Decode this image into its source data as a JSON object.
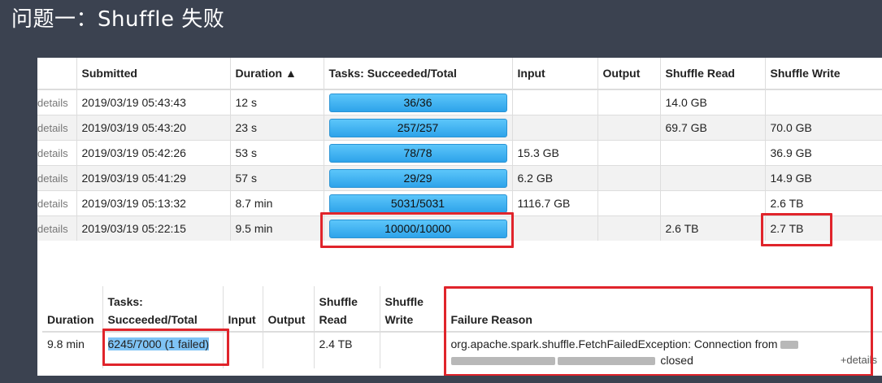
{
  "slide": {
    "title": "问题一：Shuffle 失败"
  },
  "stages_table": {
    "headers": {
      "submitted": "Submitted",
      "duration": "Duration ▲",
      "tasks": "Tasks: Succeeded/Total",
      "input": "Input",
      "output": "Output",
      "shuffle_read": "Shuffle Read",
      "shuffle_write": "Shuffle Write"
    },
    "rows": [
      {
        "details": "details",
        "submitted": "2019/03/19 05:43:43",
        "duration": "12 s",
        "tasks": "36/36",
        "tasks_fraction": 1.0,
        "input": "",
        "output": "",
        "shuffle_read": "14.0 GB",
        "shuffle_write": ""
      },
      {
        "details": "details",
        "submitted": "2019/03/19 05:43:20",
        "duration": "23 s",
        "tasks": "257/257",
        "tasks_fraction": 1.0,
        "input": "",
        "output": "",
        "shuffle_read": "69.7 GB",
        "shuffle_write": "70.0 GB"
      },
      {
        "details": "details",
        "submitted": "2019/03/19 05:42:26",
        "duration": "53 s",
        "tasks": "78/78",
        "tasks_fraction": 1.0,
        "input": "15.3 GB",
        "output": "",
        "shuffle_read": "",
        "shuffle_write": "36.9 GB"
      },
      {
        "details": "details",
        "submitted": "2019/03/19 05:41:29",
        "duration": "57 s",
        "tasks": "29/29",
        "tasks_fraction": 1.0,
        "input": "6.2 GB",
        "output": "",
        "shuffle_read": "",
        "shuffle_write": "14.9 GB"
      },
      {
        "details": "details",
        "submitted": "2019/03/19 05:13:32",
        "duration": "8.7 min",
        "tasks": "5031/5031",
        "tasks_fraction": 1.0,
        "input": "1116.7 GB",
        "output": "",
        "shuffle_read": "",
        "shuffle_write": "2.6 TB"
      },
      {
        "details": "details",
        "submitted": "2019/03/19 05:22:15",
        "duration": "9.5 min",
        "tasks": "10000/10000",
        "tasks_fraction": 1.0,
        "input": "",
        "output": "",
        "shuffle_read": "2.6 TB",
        "shuffle_write": "2.7 TB"
      }
    ]
  },
  "failed_table": {
    "headers": {
      "duration": "Duration",
      "tasks_line1": "Tasks:",
      "tasks_line2": "Succeeded/Total",
      "input": "Input",
      "output": "Output",
      "shuffle_read_line1": "Shuffle",
      "shuffle_read_line2": "Read",
      "shuffle_write_line1": "Shuffle",
      "shuffle_write_line2": "Write",
      "failure_reason": "Failure Reason"
    },
    "row": {
      "duration": "9.8 min",
      "tasks": "6245/7000 (1 failed)",
      "input": "",
      "output": "",
      "shuffle_read": "2.4 TB",
      "shuffle_write": "",
      "reason_line1": "org.apache.spark.shuffle.FetchFailedException: Connection from",
      "reason_line2_tail": "closed",
      "more": "+details"
    }
  },
  "colors": {
    "highlight_box": "#e0242b",
    "progress_bar": "#3fb3f2",
    "background": "#3b4250"
  }
}
